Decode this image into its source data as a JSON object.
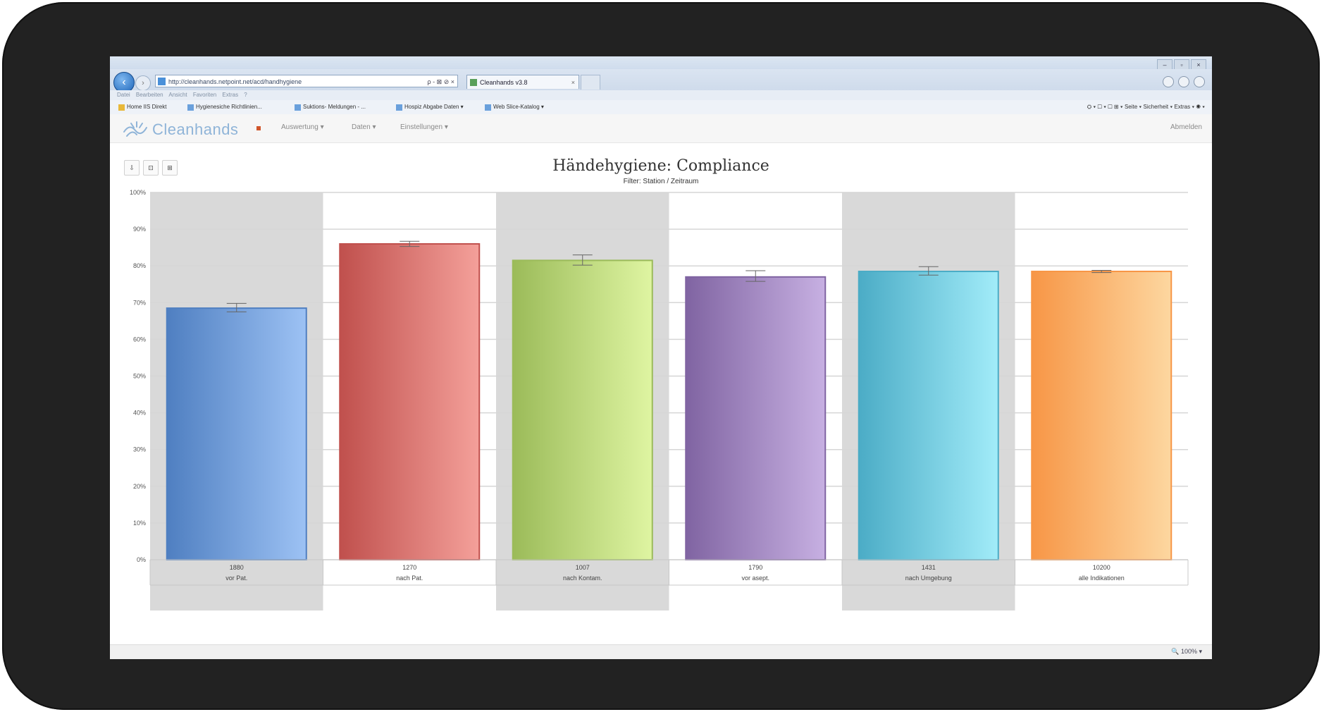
{
  "browser": {
    "url": "http://cleanhands.netpoint.net/acd/handhygiene",
    "tab_title": "Cleanhands v3.8",
    "address_tools": "ρ - ⊠ ⊘ ×",
    "tab_close": "×",
    "menu_text": "Datei Bearbeiten Ansicht Favoriten Extras ?",
    "favorites": [
      "Home IIS Direkt",
      "Hygienesiche Richtlinien...",
      "Suktions- Meldungen - ...",
      "Hospiz Abgabe Daten ▾",
      "Web Slice-Katalog ▾"
    ],
    "command_bar": "⛭ ▾ ☐ ▾ ☐ ⊞ ▾ Seite ▾ Sicherheit ▾ Extras ▾ ◉ ▾",
    "zoom": "🔍 100% ▾"
  },
  "app": {
    "logo": "Cleanhands",
    "menus": [
      "Auswertung ▾",
      "Daten ▾",
      "Einstellungen ▾"
    ],
    "user": "Abmelden"
  },
  "toolbar": [
    "⇩",
    "⊡",
    "⊞"
  ],
  "chart_data": {
    "type": "bar",
    "title": "Händehygiene: Compliance",
    "subtitle": "Filter: Station / Zeitraum",
    "ylim": [
      0,
      100
    ],
    "yticks": [
      "0%",
      "10%",
      "20%",
      "30%",
      "40%",
      "50%",
      "60%",
      "70%",
      "80%",
      "90%",
      "100%"
    ],
    "grid": true,
    "categories": [
      {
        "count": "1880",
        "label": "vor Pat."
      },
      {
        "count": "1270",
        "label": "nach Pat."
      },
      {
        "count": "1007",
        "label": "nach Kontam."
      },
      {
        "count": "1790",
        "label": "vor asept."
      },
      {
        "count": "1431",
        "label": "nach Umgebung"
      },
      {
        "count": "10200",
        "label": "alle Indikationen"
      }
    ],
    "values": [
      68.5,
      86,
      81.5,
      77,
      78.5,
      78.5
    ],
    "error_low": [
      67.5,
      85.3,
      80.2,
      75.8,
      77.5,
      78.2
    ],
    "error_high": [
      69.8,
      86.7,
      83.0,
      78.7,
      79.8,
      78.8
    ],
    "colors": [
      [
        "#4f7fc1",
        "#9dc2f4"
      ],
      [
        "#c0504d",
        "#f4a09a"
      ],
      [
        "#9bbb59",
        "#dff5a2"
      ],
      [
        "#8064a2",
        "#c7b0e2"
      ],
      [
        "#4bacc6",
        "#a2ecf9"
      ],
      [
        "#f79646",
        "#fdd7a0"
      ]
    ],
    "band_color": "#d9d9d9"
  }
}
